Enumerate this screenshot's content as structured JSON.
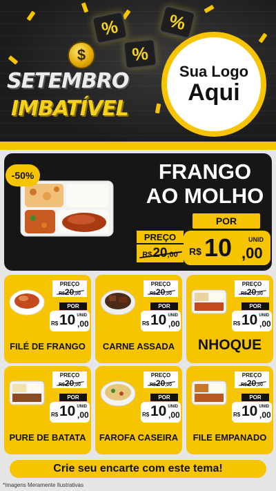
{
  "header": {
    "title_line1": "SETEMBRO",
    "title_line2": "IMBATÍVEL",
    "coin_symbol": "$",
    "percent_symbol": "%",
    "logo_line1": "Sua Logo",
    "logo_line2": "Aqui"
  },
  "featured": {
    "discount": "-50%",
    "name_line1": "FRANGO",
    "name_line2": "AO MOLHO",
    "por_label": "POR",
    "preco_label": "PREÇO",
    "old_currency": "R$",
    "old_int": "20",
    "old_cents": ",00",
    "unit": "UNID",
    "new_currency": "R$",
    "new_int": "10",
    "new_cents": ",00"
  },
  "labels": {
    "preco": "PREÇO",
    "por": "POR",
    "unid": "UNID",
    "currency": "R$",
    "old_int": "20",
    "old_cents": ",00",
    "new_int": "10",
    "new_cents": ",00"
  },
  "products": [
    {
      "name": "FILÉ DE FRANGO"
    },
    {
      "name": "CARNE ASSADA"
    },
    {
      "name": "NHOQUE"
    },
    {
      "name": "PURE DE BATATA"
    },
    {
      "name": "FAROFA CASEIRA"
    },
    {
      "name": "FILE EMPANADO"
    }
  ],
  "cta": "Crie seu encarte com este tema!",
  "disclaimer": "*Imagens Meramente Ilustrativas",
  "colors": {
    "accent": "#f6c400",
    "dark": "#161616",
    "background": "#e6e6e6"
  }
}
